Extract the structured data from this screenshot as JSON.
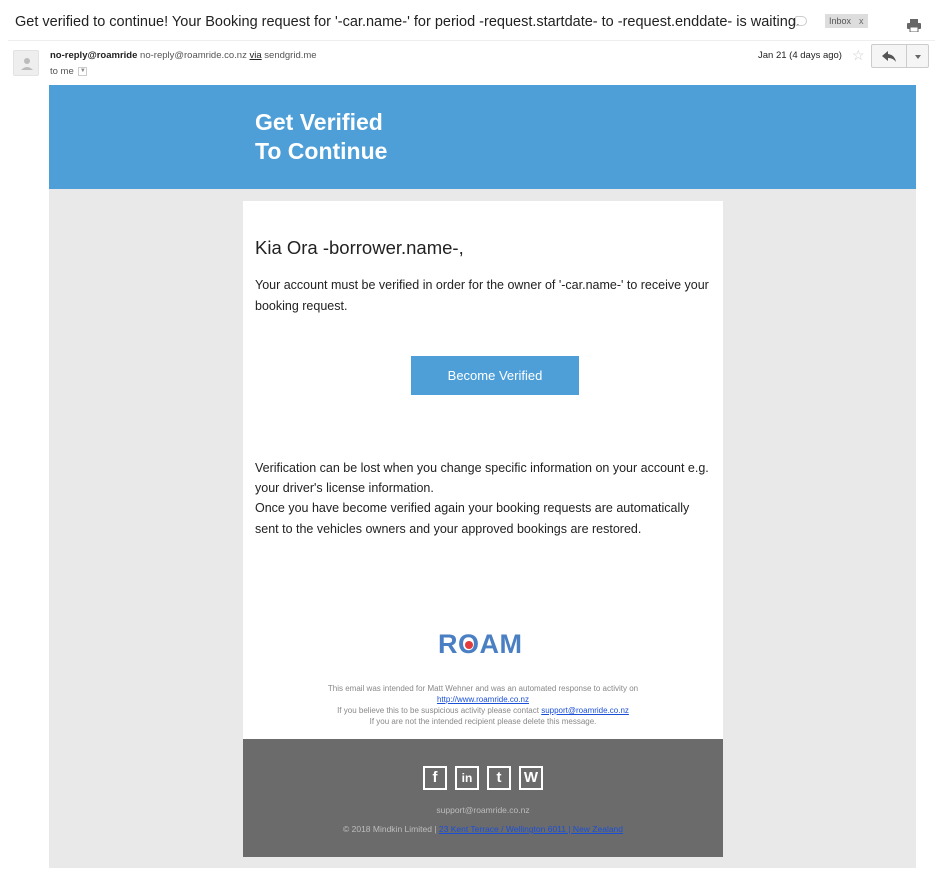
{
  "email": {
    "subject": "Get verified to continue! Your Booking request for '-car.name-' for period -request.startdate- to -request.enddate- is waiting.",
    "label": "Inbox",
    "label_close": "x",
    "sender_name": "no-reply@roamride",
    "sender_email": "no-reply@roamride.co.nz",
    "via_text": "via",
    "via_domain": "sendgrid.me",
    "to": "to me",
    "date": "Jan 21 (4 days ago)"
  },
  "icons": {
    "label": "label-icon",
    "print": "print-icon",
    "avatar": "avatar-icon",
    "star": "star-icon",
    "reply": "reply-icon",
    "more": "more-options-icon"
  },
  "colors": {
    "accent_blue": "#4e9fd8",
    "footer_grey": "#6b6b6b",
    "body_grey": "#e9e9e9",
    "logo_blue": "#4a7fc3",
    "logo_red": "#e23b3b"
  },
  "hero": {
    "line1": "Get Verified",
    "line2": "To Continue"
  },
  "body": {
    "greeting": "Kia Ora -borrower.name-,",
    "para1": "Your account must be verified in order for the owner of '-car.name-' to receive your booking request.",
    "button": "Become Verified",
    "para2a": "Verification can be lost when you change specific information on your account e.g. your driver's license information.",
    "para2b": "Once you have become verified again your booking requests are automatically sent to the vehicles owners and your approved bookings are restored."
  },
  "logo": {
    "text_r": "R",
    "text_o": "O",
    "text_am": "AM"
  },
  "fine_print": {
    "line1": "This email was intended for Matt Wehner and was an automated response to activity on",
    "link1": "http://www.roamride.co.nz",
    "line2": "If you believe this to be suspicious activity please contact",
    "link2": "support@roamride.co.nz",
    "line3": "If you are not the intended recipient please delete this message."
  },
  "footer": {
    "social": [
      "facebook-icon",
      "linkedin-icon",
      "twitter-icon",
      "wordpress-icon"
    ],
    "social_glyphs": [
      "f",
      "in",
      "t",
      "W"
    ],
    "email": "support@roamride.co.nz",
    "copyright": "© 2018 Mindkin Limited |",
    "address": "23 Kent Terrace / Wellington 6011 | New Zealand"
  }
}
